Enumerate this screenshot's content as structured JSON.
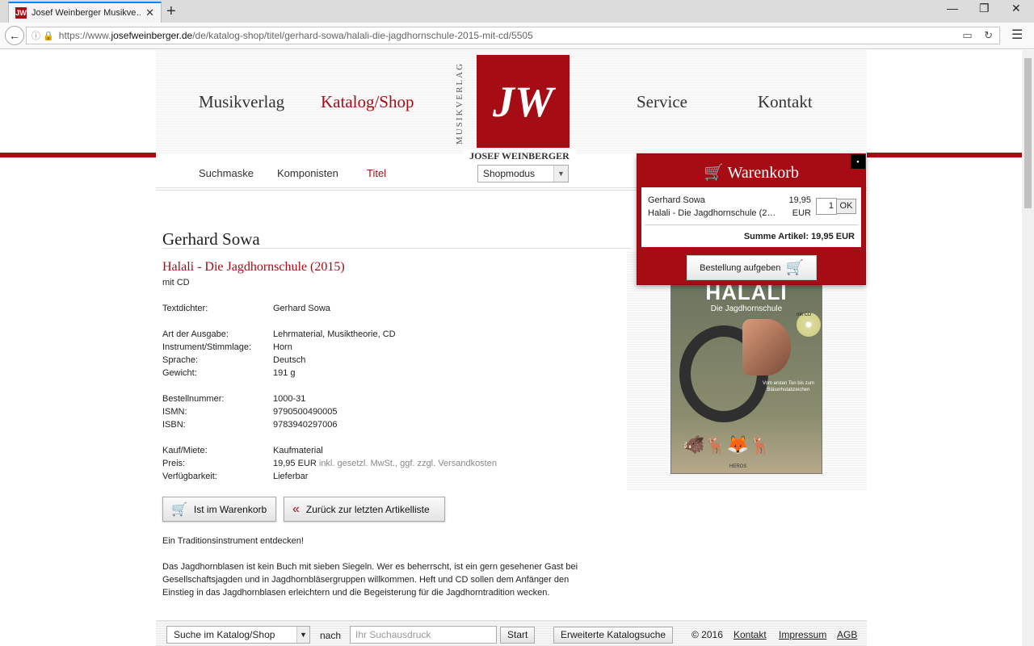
{
  "browser": {
    "tab_title": "Josef Weinberger Musikve…",
    "tab_favicon": "JW",
    "url_prefix": "https://www.",
    "url_domain": "josefweinberger.de",
    "url_path": "/de/katalog-shop/titel/gerhard-sowa/halali-die-jagdhornschule-2015-mit-cd/5505"
  },
  "nav": {
    "items": [
      "Musikverlag",
      "Katalog/Shop",
      "Service",
      "Kontakt"
    ],
    "active_color": "#a50c14"
  },
  "logo": {
    "vertical_text": "MUSIKVERLAG",
    "name": "JOSEF WEINBERGER",
    "mark": "JW"
  },
  "subnav": {
    "items": [
      "Suchmaske",
      "Komponisten",
      "Titel"
    ],
    "mode_select": "Shopmodus"
  },
  "product": {
    "composer": "Gerhard Sowa",
    "title": "Halali - Die Jagdhornschule (2015)",
    "subtitle": "mit CD",
    "details": [
      {
        "label": "Textdichter:",
        "value": "Gerhard Sowa"
      },
      {
        "label": "Art der Ausgabe:",
        "value": "Lehrmaterial, Musiktheorie, CD"
      },
      {
        "label": "Instrument/Stimmlage:",
        "value": "Horn"
      },
      {
        "label": "Sprache:",
        "value": "Deutsch"
      },
      {
        "label": "Gewicht:",
        "value": "191 g"
      },
      {
        "label": "Bestellnummer:",
        "value": "1000-31"
      },
      {
        "label": "ISMN:",
        "value": "9790500490005"
      },
      {
        "label": "ISBN:",
        "value": "9783940297006"
      },
      {
        "label": "Kauf/Miete:",
        "value": "Kaufmaterial"
      },
      {
        "label": "Preis:",
        "value": "19,95 EUR",
        "note": "inkl. gesetzl. MwSt., ggf. zzgl. Versandkosten"
      },
      {
        "label": "Verfügbarkeit:",
        "value": "Lieferbar"
      }
    ],
    "btn_in_cart": "Ist im Warenkorb",
    "btn_back": "Zurück zur letzten Artikelliste",
    "desc_heading": "Ein Traditionsinstrument entdecken!",
    "desc_body": "Das Jagdhornblasen ist kein Buch mit sieben Siegeln. Wer es beherrscht, ist ein gern gesehener Gast bei Gesellschaftsjagden und in Jagdhornbläsergruppen willkommen. Heft und CD sollen dem Anfänger den Einstieg in das Jagdhornblasen erleichtern und die Begeisterung für die Jagdhorntradition wecken."
  },
  "cover": {
    "title": "HALALI",
    "subtitle": "Die Jagdhornschule",
    "cd": "mit CD",
    "tagline": "Vom ersten Ton bis zum Bläserhutabzeichen",
    "publisher": "HEROS"
  },
  "cart": {
    "heading": "Warenkorb",
    "item_composer": "Gerhard Sowa",
    "item_title": "Halali - Die Jagdhornschule (2…",
    "price": "19,95",
    "currency": "EUR",
    "qty": "1",
    "ok": "OK",
    "sum": "Summe Artikel: 19,95 EUR",
    "order_button": "Bestellung aufgeben",
    "close": "▪"
  },
  "footer": {
    "select": "Suche im Katalog/Shop",
    "nach": "nach",
    "placeholder": "Ihr Suchausdruck",
    "start": "Start",
    "advanced": "Erweiterte Katalogsuche",
    "copyright": "© 2016",
    "links": [
      "Kontakt",
      "Impressum",
      "AGB"
    ]
  }
}
